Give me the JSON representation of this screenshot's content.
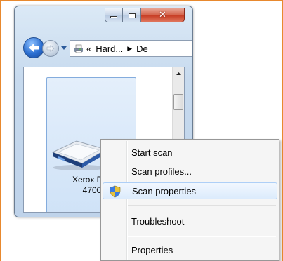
{
  "window": {
    "address": {
      "prefix": "«",
      "segment1": "Hard...",
      "separator": "▶",
      "segment2": "De"
    },
    "device": {
      "label_line1": "Xerox Doc",
      "label_line2": "4700"
    }
  },
  "context_menu": {
    "items": [
      {
        "label": "Start scan"
      },
      {
        "label": "Scan profiles..."
      },
      {
        "label": "Scan properties",
        "highlighted": true,
        "icon": "uac-shield-icon"
      },
      {
        "label": "Troubleshoot"
      },
      {
        "label": "Properties"
      }
    ]
  },
  "colors": {
    "accent_frame": "#e8892e",
    "menu_highlight": "#dcebfc",
    "close_button": "#c63b22"
  }
}
